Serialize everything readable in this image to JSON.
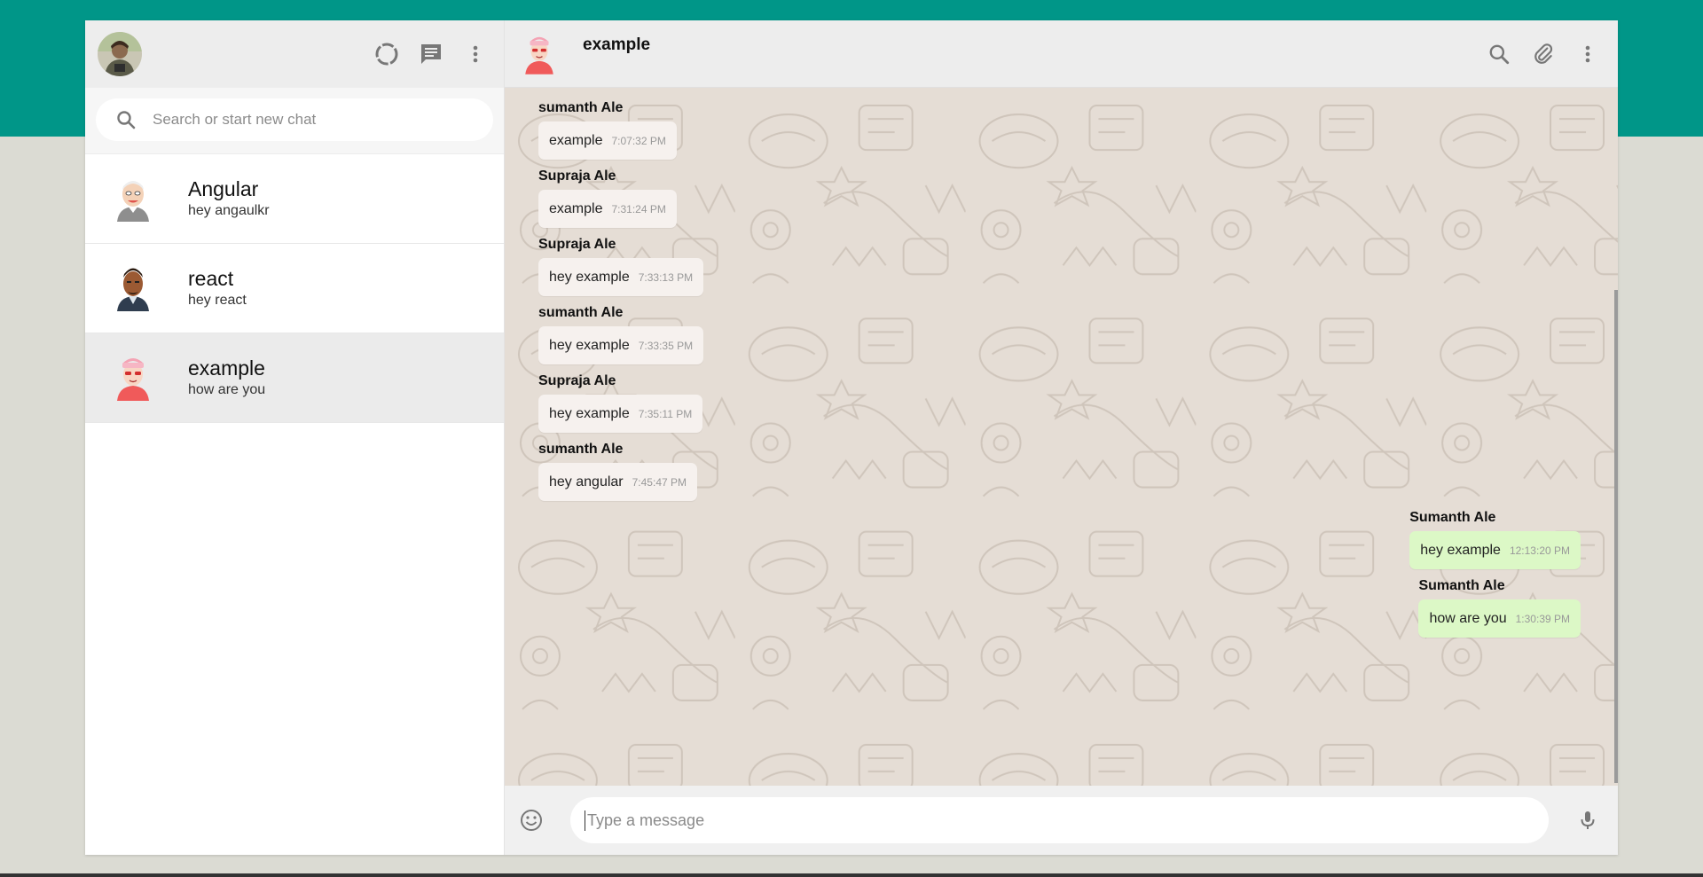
{
  "sidebar": {
    "search_placeholder": "Search or start new chat",
    "chats": [
      {
        "name": "Angular",
        "last_message": "hey angaulkr"
      },
      {
        "name": "react",
        "last_message": "hey react"
      },
      {
        "name": "example",
        "last_message": "how are you"
      }
    ]
  },
  "conversation": {
    "title": "example",
    "messages": [
      {
        "sender": "sumanth Ale",
        "text": "example",
        "time": "7:07:32 PM",
        "direction": "incoming"
      },
      {
        "sender": "Supraja Ale",
        "text": "example",
        "time": "7:31:24 PM",
        "direction": "incoming"
      },
      {
        "sender": "Supraja Ale",
        "text": "hey example",
        "time": "7:33:13 PM",
        "direction": "incoming"
      },
      {
        "sender": "sumanth Ale",
        "text": "hey example",
        "time": "7:33:35 PM",
        "direction": "incoming"
      },
      {
        "sender": "Supraja Ale",
        "text": "hey example",
        "time": "7:35:11 PM",
        "direction": "incoming"
      },
      {
        "sender": "sumanth Ale",
        "text": "hey angular",
        "time": "7:45:47 PM",
        "direction": "incoming"
      },
      {
        "sender": "Sumanth Ale",
        "text": "hey example",
        "time": "12:13:20 PM",
        "direction": "outgoing"
      },
      {
        "sender": "Sumanth Ale",
        "text": "how are you",
        "time": "1:30:39 PM",
        "direction": "outgoing"
      }
    ],
    "input_placeholder": "Type a message"
  },
  "icons": {
    "status": "status-icon",
    "new_chat": "chat-icon",
    "menu": "more-vert-icon",
    "search": "search-icon",
    "attach": "paperclip-icon",
    "emoji": "emoji-icon",
    "mic": "mic-icon"
  },
  "colors": {
    "brand": "#009688",
    "outgoing_bubble": "#dcf8c6",
    "incoming_bubble": "#f6f1ee",
    "chat_background": "#e5ddd5"
  }
}
